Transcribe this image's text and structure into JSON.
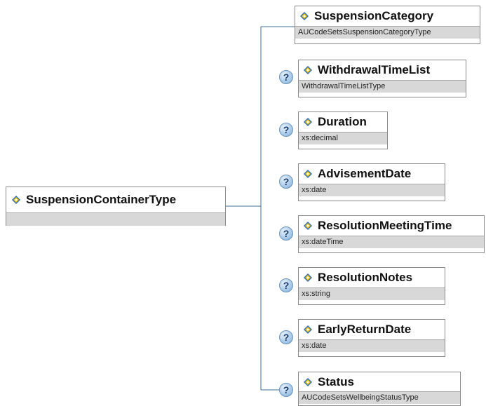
{
  "root": {
    "name": "SuspensionContainerType"
  },
  "children": [
    {
      "name": "SuspensionCategory",
      "type": "AUCodeSetsSuspensionCategoryType",
      "optional": false
    },
    {
      "name": "WithdrawalTimeList",
      "type": "WithdrawalTimeListType",
      "optional": true
    },
    {
      "name": "Duration",
      "type": "xs:decimal",
      "optional": true
    },
    {
      "name": "AdvisementDate",
      "type": "xs:date",
      "optional": true
    },
    {
      "name": "ResolutionMeetingTime",
      "type": "xs:dateTime",
      "optional": true
    },
    {
      "name": "ResolutionNotes",
      "type": "xs:string",
      "optional": true
    },
    {
      "name": "EarlyReturnDate",
      "type": "xs:date",
      "optional": true
    },
    {
      "name": "Status",
      "type": "AUCodeSetsWellbeingStatusType",
      "optional": true
    }
  ],
  "optional_marker": "?",
  "colors": {
    "line": "#3b6f9a",
    "box_border": "#8a8a8a",
    "type_bg": "#d8d8d8",
    "icon_blue": "#2f6fb5",
    "icon_yellow": "#f2c200"
  }
}
